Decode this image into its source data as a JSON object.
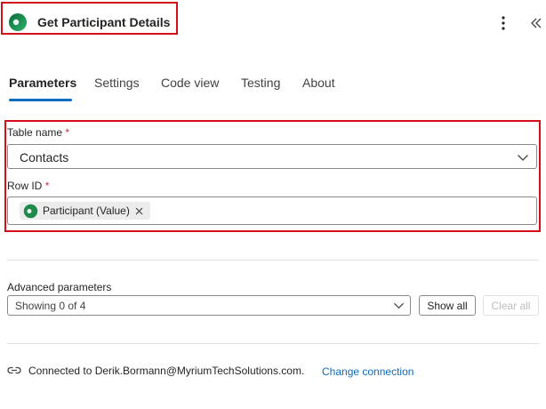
{
  "header": {
    "title": "Get Participant Details",
    "app_icon": "dataverse-icon",
    "more_icon": "more-vertical-icon",
    "collapse_icon": "double-chevron-left-icon"
  },
  "tabs": [
    {
      "label": "Parameters",
      "active": true
    },
    {
      "label": "Settings",
      "active": false
    },
    {
      "label": "Code view",
      "active": false
    },
    {
      "label": "Testing",
      "active": false
    },
    {
      "label": "About",
      "active": false
    }
  ],
  "fields": {
    "table_name": {
      "label": "Table name",
      "required_mark": "*",
      "value": "Contacts"
    },
    "row_id": {
      "label": "Row ID",
      "required_mark": "*",
      "token": "Participant (Value)"
    }
  },
  "advanced": {
    "label": "Advanced parameters",
    "select_value": "Showing 0 of 4",
    "show_all": "Show all",
    "clear_all": "Clear all"
  },
  "connection": {
    "text": "Connected to Derik.Bormann@MyriumTechSolutions.com.",
    "change_link": "Change connection"
  },
  "colors": {
    "accent": "#0f6cbd",
    "highlight_border": "#d3101a",
    "required": "#c4314b"
  }
}
